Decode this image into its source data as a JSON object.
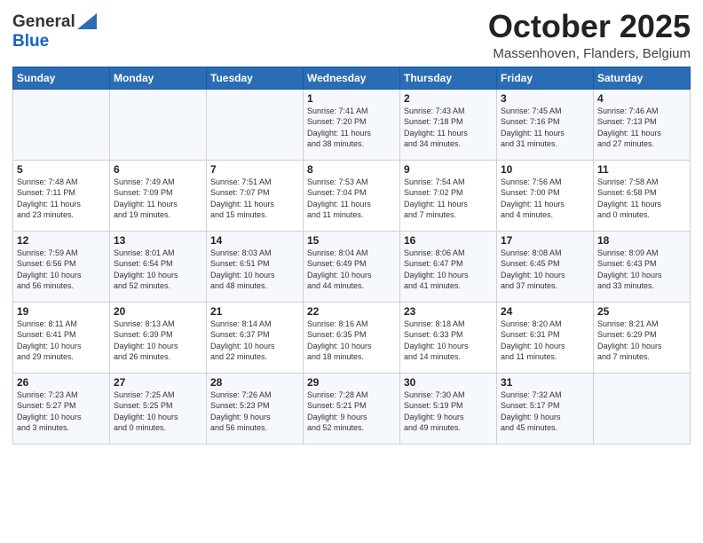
{
  "header": {
    "logo_general": "General",
    "logo_blue": "Blue",
    "month": "October 2025",
    "location": "Massenhoven, Flanders, Belgium"
  },
  "weekdays": [
    "Sunday",
    "Monday",
    "Tuesday",
    "Wednesday",
    "Thursday",
    "Friday",
    "Saturday"
  ],
  "weeks": [
    [
      {
        "day": "",
        "info": ""
      },
      {
        "day": "",
        "info": ""
      },
      {
        "day": "",
        "info": ""
      },
      {
        "day": "1",
        "info": "Sunrise: 7:41 AM\nSunset: 7:20 PM\nDaylight: 11 hours\nand 38 minutes."
      },
      {
        "day": "2",
        "info": "Sunrise: 7:43 AM\nSunset: 7:18 PM\nDaylight: 11 hours\nand 34 minutes."
      },
      {
        "day": "3",
        "info": "Sunrise: 7:45 AM\nSunset: 7:16 PM\nDaylight: 11 hours\nand 31 minutes."
      },
      {
        "day": "4",
        "info": "Sunrise: 7:46 AM\nSunset: 7:13 PM\nDaylight: 11 hours\nand 27 minutes."
      }
    ],
    [
      {
        "day": "5",
        "info": "Sunrise: 7:48 AM\nSunset: 7:11 PM\nDaylight: 11 hours\nand 23 minutes."
      },
      {
        "day": "6",
        "info": "Sunrise: 7:49 AM\nSunset: 7:09 PM\nDaylight: 11 hours\nand 19 minutes."
      },
      {
        "day": "7",
        "info": "Sunrise: 7:51 AM\nSunset: 7:07 PM\nDaylight: 11 hours\nand 15 minutes."
      },
      {
        "day": "8",
        "info": "Sunrise: 7:53 AM\nSunset: 7:04 PM\nDaylight: 11 hours\nand 11 minutes."
      },
      {
        "day": "9",
        "info": "Sunrise: 7:54 AM\nSunset: 7:02 PM\nDaylight: 11 hours\nand 7 minutes."
      },
      {
        "day": "10",
        "info": "Sunrise: 7:56 AM\nSunset: 7:00 PM\nDaylight: 11 hours\nand 4 minutes."
      },
      {
        "day": "11",
        "info": "Sunrise: 7:58 AM\nSunset: 6:58 PM\nDaylight: 11 hours\nand 0 minutes."
      }
    ],
    [
      {
        "day": "12",
        "info": "Sunrise: 7:59 AM\nSunset: 6:56 PM\nDaylight: 10 hours\nand 56 minutes."
      },
      {
        "day": "13",
        "info": "Sunrise: 8:01 AM\nSunset: 6:54 PM\nDaylight: 10 hours\nand 52 minutes."
      },
      {
        "day": "14",
        "info": "Sunrise: 8:03 AM\nSunset: 6:51 PM\nDaylight: 10 hours\nand 48 minutes."
      },
      {
        "day": "15",
        "info": "Sunrise: 8:04 AM\nSunset: 6:49 PM\nDaylight: 10 hours\nand 44 minutes."
      },
      {
        "day": "16",
        "info": "Sunrise: 8:06 AM\nSunset: 6:47 PM\nDaylight: 10 hours\nand 41 minutes."
      },
      {
        "day": "17",
        "info": "Sunrise: 8:08 AM\nSunset: 6:45 PM\nDaylight: 10 hours\nand 37 minutes."
      },
      {
        "day": "18",
        "info": "Sunrise: 8:09 AM\nSunset: 6:43 PM\nDaylight: 10 hours\nand 33 minutes."
      }
    ],
    [
      {
        "day": "19",
        "info": "Sunrise: 8:11 AM\nSunset: 6:41 PM\nDaylight: 10 hours\nand 29 minutes."
      },
      {
        "day": "20",
        "info": "Sunrise: 8:13 AM\nSunset: 6:39 PM\nDaylight: 10 hours\nand 26 minutes."
      },
      {
        "day": "21",
        "info": "Sunrise: 8:14 AM\nSunset: 6:37 PM\nDaylight: 10 hours\nand 22 minutes."
      },
      {
        "day": "22",
        "info": "Sunrise: 8:16 AM\nSunset: 6:35 PM\nDaylight: 10 hours\nand 18 minutes."
      },
      {
        "day": "23",
        "info": "Sunrise: 8:18 AM\nSunset: 6:33 PM\nDaylight: 10 hours\nand 14 minutes."
      },
      {
        "day": "24",
        "info": "Sunrise: 8:20 AM\nSunset: 6:31 PM\nDaylight: 10 hours\nand 11 minutes."
      },
      {
        "day": "25",
        "info": "Sunrise: 8:21 AM\nSunset: 6:29 PM\nDaylight: 10 hours\nand 7 minutes."
      }
    ],
    [
      {
        "day": "26",
        "info": "Sunrise: 7:23 AM\nSunset: 5:27 PM\nDaylight: 10 hours\nand 3 minutes."
      },
      {
        "day": "27",
        "info": "Sunrise: 7:25 AM\nSunset: 5:25 PM\nDaylight: 10 hours\nand 0 minutes."
      },
      {
        "day": "28",
        "info": "Sunrise: 7:26 AM\nSunset: 5:23 PM\nDaylight: 9 hours\nand 56 minutes."
      },
      {
        "day": "29",
        "info": "Sunrise: 7:28 AM\nSunset: 5:21 PM\nDaylight: 9 hours\nand 52 minutes."
      },
      {
        "day": "30",
        "info": "Sunrise: 7:30 AM\nSunset: 5:19 PM\nDaylight: 9 hours\nand 49 minutes."
      },
      {
        "day": "31",
        "info": "Sunrise: 7:32 AM\nSunset: 5:17 PM\nDaylight: 9 hours\nand 45 minutes."
      },
      {
        "day": "",
        "info": ""
      }
    ]
  ]
}
